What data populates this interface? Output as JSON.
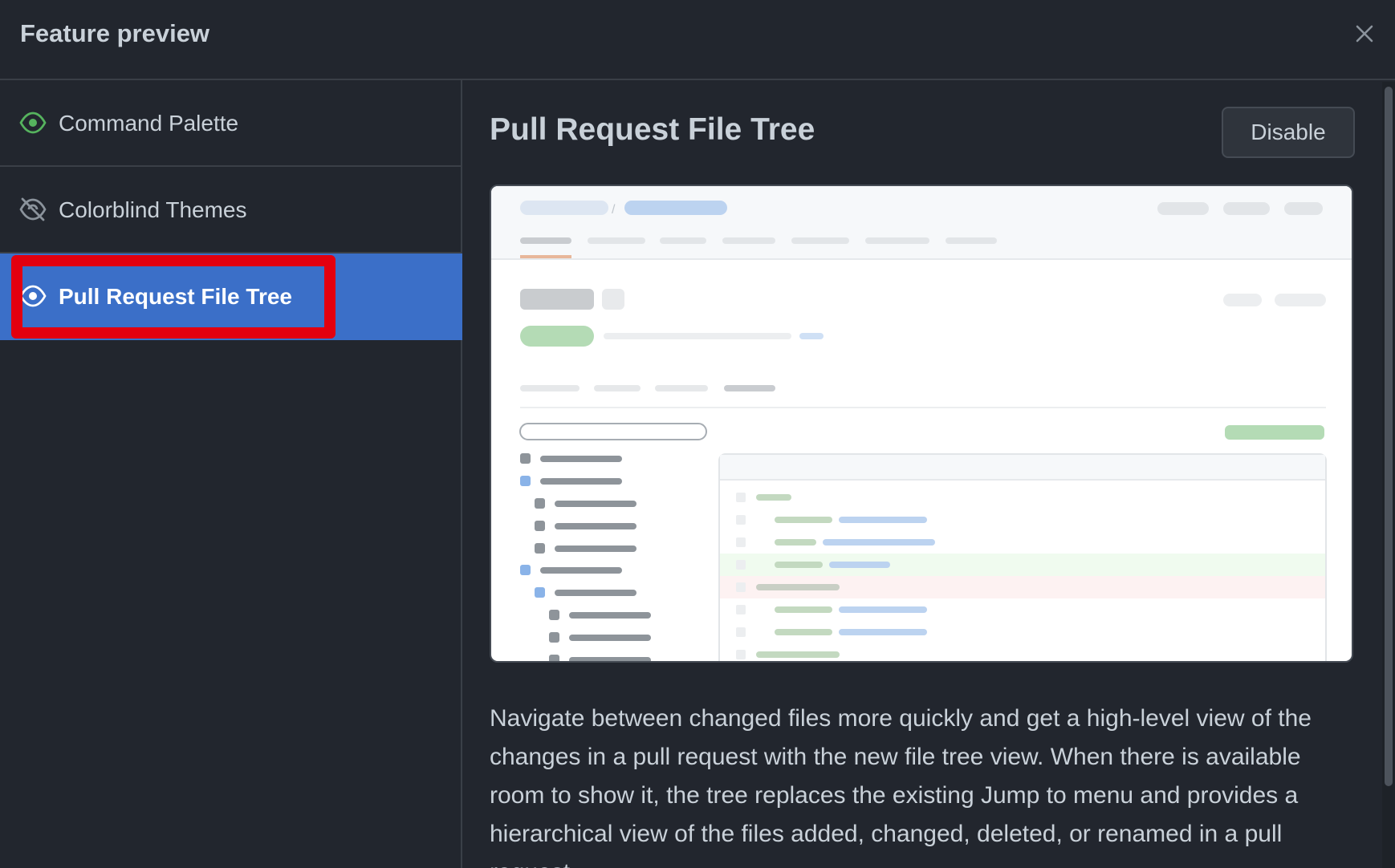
{
  "dialog": {
    "title": "Feature preview"
  },
  "sidebar": {
    "items": [
      {
        "label": "Command Palette",
        "icon": "eye-icon",
        "enabled": true
      },
      {
        "label": "Colorblind Themes",
        "icon": "eye-closed-icon",
        "enabled": false
      },
      {
        "label": "Pull Request File Tree",
        "icon": "eye-icon",
        "enabled": true,
        "selected": true
      }
    ]
  },
  "main": {
    "feature_title": "Pull Request File Tree",
    "disable_label": "Disable",
    "description": "Navigate between changed files more quickly and get a high-level view of the changes in a pull request with the new file tree view. When there is available room to show it, the tree replaces the existing Jump to menu and provides a hierarchical view of the files added, changed, deleted, or renamed in a pull request."
  },
  "colors": {
    "background": "#22262e",
    "selected": "#3b6fc8",
    "enabled_icon": "#56b35e",
    "highlight": "#e3000f"
  }
}
